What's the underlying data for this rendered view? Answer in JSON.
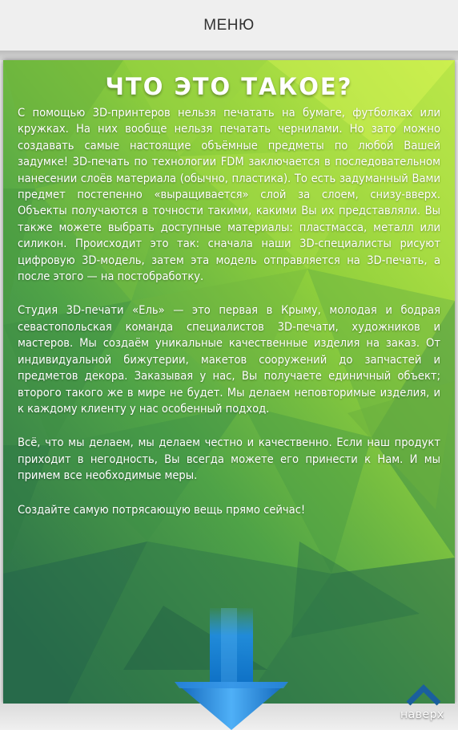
{
  "header": {
    "menu_label": "МЕНЮ"
  },
  "section": {
    "title": "ЧТО ЭТО ТАКОЕ?",
    "paragraphs": [
      "С помощью 3D-принтеров нельзя печатать на бумаге, футболках или кружках. На них вообще нельзя печатать чернилами. Но зато можно создавать самые настоящие объёмные предметы по любой Вашей задумке! 3D-печать по технологии FDM заключается в последовательном нанесении слоёв материала (обычно, пластика). То есть задуманный Вами предмет постепенно «выращивается» слой за слоем, снизу-вверх. Объекты получаются в точности такими, какими Вы их представляли. Вы также можете выбрать доступные материалы: пластмасса, металл или силикон. Происходит это так: сначала наши 3D-специалисты рисуют цифровую 3D-модель, затем эта модель отправляется на 3D-печать, а после этого — на постобработку.",
      "Студия 3D-печати «Ель» — это первая в Крыму, молодая и бодрая севастопольская команда специалистов 3D-печати, художников и мастеров. Мы создаём уникальные качественные изделия на заказ. От индивидуальной бижутерии, макетов сооружений до запчастей и предметов декора. Заказывая у нас, Вы получаете единичный объект; второго такого же в мире не будет. Мы делаем неповторимые изделия, и к каждому клиенту у нас особенный подход.",
      "Всё, что мы делаем, мы делаем честно и качественно. Если наш продукт приходит в негодность, Вы всегда можете его принести к Нам. И мы примем все необходимые меры.",
      "Создайте самую потрясающую вещь прямо сейчас!"
    ]
  },
  "scroll_top": {
    "label": "наверх",
    "icon": "chevron-up-icon"
  },
  "scroll_down": {
    "icon": "arrow-down-icon"
  },
  "colors": {
    "bg_light": "#c4ea48",
    "bg_mid": "#7fc43f",
    "bg_dark": "#2f7f4e",
    "arrow_blue": "#1f8be0",
    "chevron_blue": "#1a5f9e"
  }
}
